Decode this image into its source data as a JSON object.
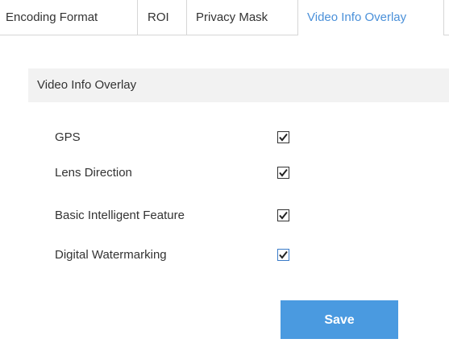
{
  "tabs": [
    {
      "label": "Encoding Format",
      "active": false
    },
    {
      "label": "ROI",
      "active": false
    },
    {
      "label": "Privacy Mask",
      "active": false
    },
    {
      "label": "Video Info Overlay",
      "active": true
    }
  ],
  "section": {
    "title": "Video Info Overlay"
  },
  "options": [
    {
      "label": "GPS",
      "checked": true
    },
    {
      "label": "Lens Direction",
      "checked": true
    },
    {
      "label": "Basic Intelligent Feature",
      "checked": true
    },
    {
      "label": "Digital Watermarking",
      "checked": true
    }
  ],
  "actions": {
    "save_label": "Save"
  },
  "colors": {
    "accent": "#4a90d9",
    "button": "#4a9ae0",
    "header_bg": "#f2f2f2"
  }
}
